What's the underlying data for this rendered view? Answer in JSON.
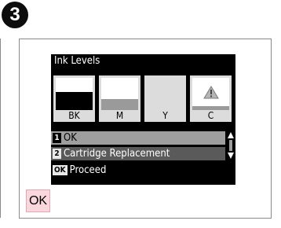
{
  "step": {
    "number": "3"
  },
  "lcd": {
    "title": "Ink Levels",
    "cartridges": [
      {
        "label": "BK",
        "level": 0.55,
        "fill_color": "#000000",
        "warning": false
      },
      {
        "label": "M",
        "level": 0.35,
        "fill_color": "#9a9a9a",
        "warning": false
      },
      {
        "label": "Y",
        "level": 0.0,
        "fill_color": "#dcdcdc",
        "warning": false
      },
      {
        "label": "C",
        "level": 0.12,
        "fill_color": "#9a9a9a",
        "warning": true,
        "icon": "warning-icon"
      }
    ],
    "menu": [
      {
        "key": "1",
        "label": "OK",
        "selected": true
      },
      {
        "key": "2",
        "label": "Cartridge Replacement",
        "selected": false
      }
    ],
    "footer": {
      "key": "OK",
      "label": "Proceed"
    }
  },
  "ok_button": {
    "label": "OK",
    "color": "#fad7dc"
  }
}
